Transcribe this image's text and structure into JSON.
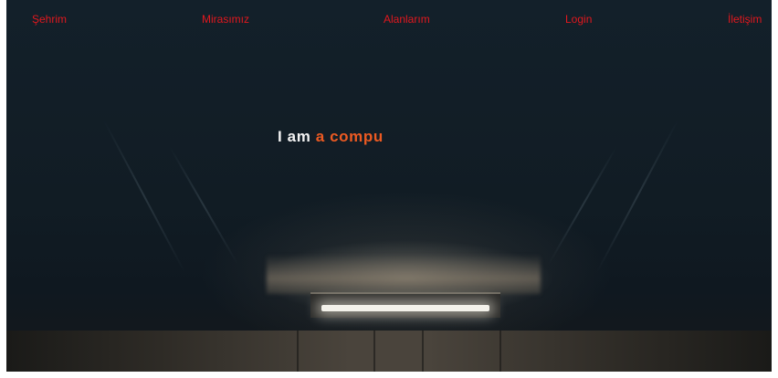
{
  "nav": {
    "items": [
      {
        "label": "Şehrim"
      },
      {
        "label": "Mirasımız"
      },
      {
        "label": "Alanlarım"
      },
      {
        "label": "Login"
      },
      {
        "label": "İletişim"
      }
    ],
    "link_color": "#e1181e"
  },
  "hero": {
    "headline_static": "I am",
    "headline_typed": "a compu",
    "static_color": "#f2f2f2",
    "typed_color": "#ec5a22",
    "background_color": "#13202a"
  }
}
